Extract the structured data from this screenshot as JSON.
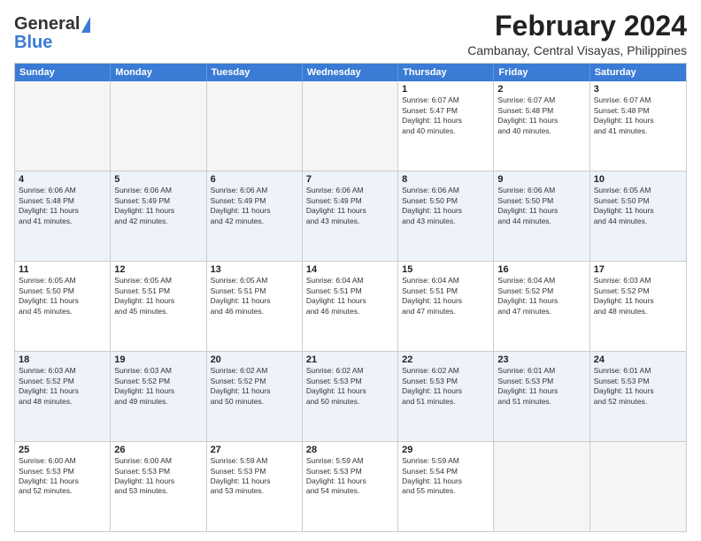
{
  "header": {
    "logo_general": "General",
    "logo_blue": "Blue",
    "month_title": "February 2024",
    "location": "Cambanay, Central Visayas, Philippines"
  },
  "calendar": {
    "days_of_week": [
      "Sunday",
      "Monday",
      "Tuesday",
      "Wednesday",
      "Thursday",
      "Friday",
      "Saturday"
    ],
    "rows": [
      [
        {
          "day": "",
          "info": ""
        },
        {
          "day": "",
          "info": ""
        },
        {
          "day": "",
          "info": ""
        },
        {
          "day": "",
          "info": ""
        },
        {
          "day": "1",
          "info": "Sunrise: 6:07 AM\nSunset: 5:47 PM\nDaylight: 11 hours\nand 40 minutes."
        },
        {
          "day": "2",
          "info": "Sunrise: 6:07 AM\nSunset: 5:48 PM\nDaylight: 11 hours\nand 40 minutes."
        },
        {
          "day": "3",
          "info": "Sunrise: 6:07 AM\nSunset: 5:48 PM\nDaylight: 11 hours\nand 41 minutes."
        }
      ],
      [
        {
          "day": "4",
          "info": "Sunrise: 6:06 AM\nSunset: 5:48 PM\nDaylight: 11 hours\nand 41 minutes."
        },
        {
          "day": "5",
          "info": "Sunrise: 6:06 AM\nSunset: 5:49 PM\nDaylight: 11 hours\nand 42 minutes."
        },
        {
          "day": "6",
          "info": "Sunrise: 6:06 AM\nSunset: 5:49 PM\nDaylight: 11 hours\nand 42 minutes."
        },
        {
          "day": "7",
          "info": "Sunrise: 6:06 AM\nSunset: 5:49 PM\nDaylight: 11 hours\nand 43 minutes."
        },
        {
          "day": "8",
          "info": "Sunrise: 6:06 AM\nSunset: 5:50 PM\nDaylight: 11 hours\nand 43 minutes."
        },
        {
          "day": "9",
          "info": "Sunrise: 6:06 AM\nSunset: 5:50 PM\nDaylight: 11 hours\nand 44 minutes."
        },
        {
          "day": "10",
          "info": "Sunrise: 6:05 AM\nSunset: 5:50 PM\nDaylight: 11 hours\nand 44 minutes."
        }
      ],
      [
        {
          "day": "11",
          "info": "Sunrise: 6:05 AM\nSunset: 5:50 PM\nDaylight: 11 hours\nand 45 minutes."
        },
        {
          "day": "12",
          "info": "Sunrise: 6:05 AM\nSunset: 5:51 PM\nDaylight: 11 hours\nand 45 minutes."
        },
        {
          "day": "13",
          "info": "Sunrise: 6:05 AM\nSunset: 5:51 PM\nDaylight: 11 hours\nand 46 minutes."
        },
        {
          "day": "14",
          "info": "Sunrise: 6:04 AM\nSunset: 5:51 PM\nDaylight: 11 hours\nand 46 minutes."
        },
        {
          "day": "15",
          "info": "Sunrise: 6:04 AM\nSunset: 5:51 PM\nDaylight: 11 hours\nand 47 minutes."
        },
        {
          "day": "16",
          "info": "Sunrise: 6:04 AM\nSunset: 5:52 PM\nDaylight: 11 hours\nand 47 minutes."
        },
        {
          "day": "17",
          "info": "Sunrise: 6:03 AM\nSunset: 5:52 PM\nDaylight: 11 hours\nand 48 minutes."
        }
      ],
      [
        {
          "day": "18",
          "info": "Sunrise: 6:03 AM\nSunset: 5:52 PM\nDaylight: 11 hours\nand 48 minutes."
        },
        {
          "day": "19",
          "info": "Sunrise: 6:03 AM\nSunset: 5:52 PM\nDaylight: 11 hours\nand 49 minutes."
        },
        {
          "day": "20",
          "info": "Sunrise: 6:02 AM\nSunset: 5:52 PM\nDaylight: 11 hours\nand 50 minutes."
        },
        {
          "day": "21",
          "info": "Sunrise: 6:02 AM\nSunset: 5:53 PM\nDaylight: 11 hours\nand 50 minutes."
        },
        {
          "day": "22",
          "info": "Sunrise: 6:02 AM\nSunset: 5:53 PM\nDaylight: 11 hours\nand 51 minutes."
        },
        {
          "day": "23",
          "info": "Sunrise: 6:01 AM\nSunset: 5:53 PM\nDaylight: 11 hours\nand 51 minutes."
        },
        {
          "day": "24",
          "info": "Sunrise: 6:01 AM\nSunset: 5:53 PM\nDaylight: 11 hours\nand 52 minutes."
        }
      ],
      [
        {
          "day": "25",
          "info": "Sunrise: 6:00 AM\nSunset: 5:53 PM\nDaylight: 11 hours\nand 52 minutes."
        },
        {
          "day": "26",
          "info": "Sunrise: 6:00 AM\nSunset: 5:53 PM\nDaylight: 11 hours\nand 53 minutes."
        },
        {
          "day": "27",
          "info": "Sunrise: 5:59 AM\nSunset: 5:53 PM\nDaylight: 11 hours\nand 53 minutes."
        },
        {
          "day": "28",
          "info": "Sunrise: 5:59 AM\nSunset: 5:53 PM\nDaylight: 11 hours\nand 54 minutes."
        },
        {
          "day": "29",
          "info": "Sunrise: 5:59 AM\nSunset: 5:54 PM\nDaylight: 11 hours\nand 55 minutes."
        },
        {
          "day": "",
          "info": ""
        },
        {
          "day": "",
          "info": ""
        }
      ]
    ]
  }
}
